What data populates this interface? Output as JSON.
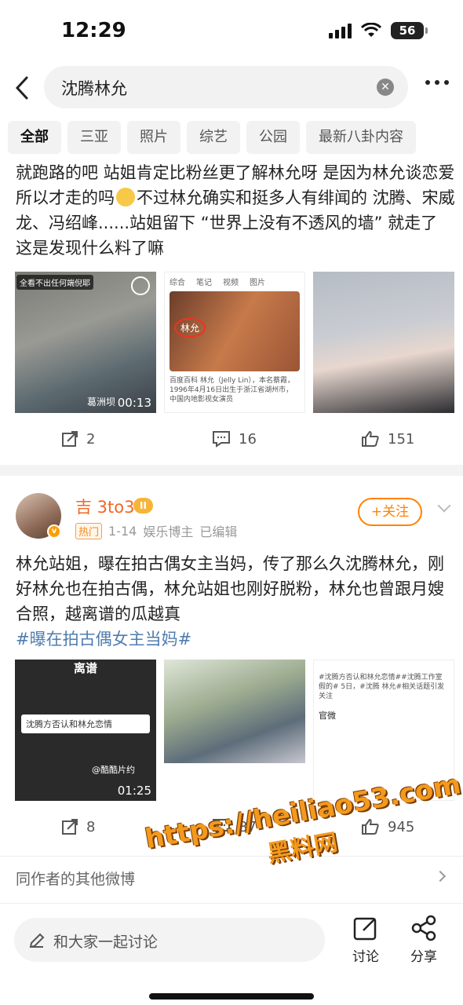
{
  "status_bar": {
    "time": "12:29",
    "battery": "56"
  },
  "search": {
    "query": "沈腾林允"
  },
  "tabs": [
    "全部",
    "三亚",
    "照片",
    "综艺",
    "公园",
    "最新八卦内容"
  ],
  "post1": {
    "text_a": "就跑路的吧 站姐肯定比粉丝更了解林允呀 是因为林允谈恋爱所以才走的吗",
    "text_b": "不过林允确实和挺多人有绯闻的 沈腾、宋威龙、冯绍峰......站姐留下 “世界上没有不透风的墙” 就走了 这是发现什么料了嘛",
    "images": {
      "img1_badge": "全看不出任何端倪耶",
      "img1_watermark": "葛洲坝",
      "img1_duration": "00:13",
      "img2_name": "林允",
      "img2_tabs": [
        "综合",
        "笔记",
        "视频",
        "图片"
      ],
      "img2_desc": "百度百科 林允（Jelly Lin），本名蔡霞，1996年4月16日出生于浙江省湖州市，中国内地影视女演员"
    },
    "actions": {
      "repost": "2",
      "comment": "16",
      "like": "151"
    }
  },
  "post2": {
    "author": "吉 3to3",
    "level": "II",
    "hot_tag": "热门",
    "date": "1-14",
    "role": "娱乐博主",
    "edited": "已编辑",
    "follow_label": "+关注",
    "text": "林允站姐，曝在拍古偶女主当妈，传了那么久沈腾林允，刚好林允也在拍古偶，林允站姐也刚好脱粉，林允也曾跟月嫂合照，越离谱的瓜越真",
    "hashtag": "#曝在拍古偶女主当妈#",
    "images": {
      "img4_title": "离谱",
      "img4_caption": "沈腾方否认和林允恋情",
      "img4_watermark": "@酷酷片约",
      "img4_duration": "01:25",
      "img6_text": "#沈腾方否认和林允恋情##沈腾工作室 假的# 5日，#沈腾 林允#相关话题引发关注",
      "img6_label": "官微"
    },
    "actions": {
      "repost": "8",
      "comment": "87",
      "like": "945"
    }
  },
  "other_works": "同作者的其他微博",
  "watermark": {
    "url": "https://heiliao53.com",
    "site": "黑料网"
  },
  "bottom": {
    "placeholder": "和大家一起讨论",
    "discuss": "讨论",
    "share": "分享"
  }
}
